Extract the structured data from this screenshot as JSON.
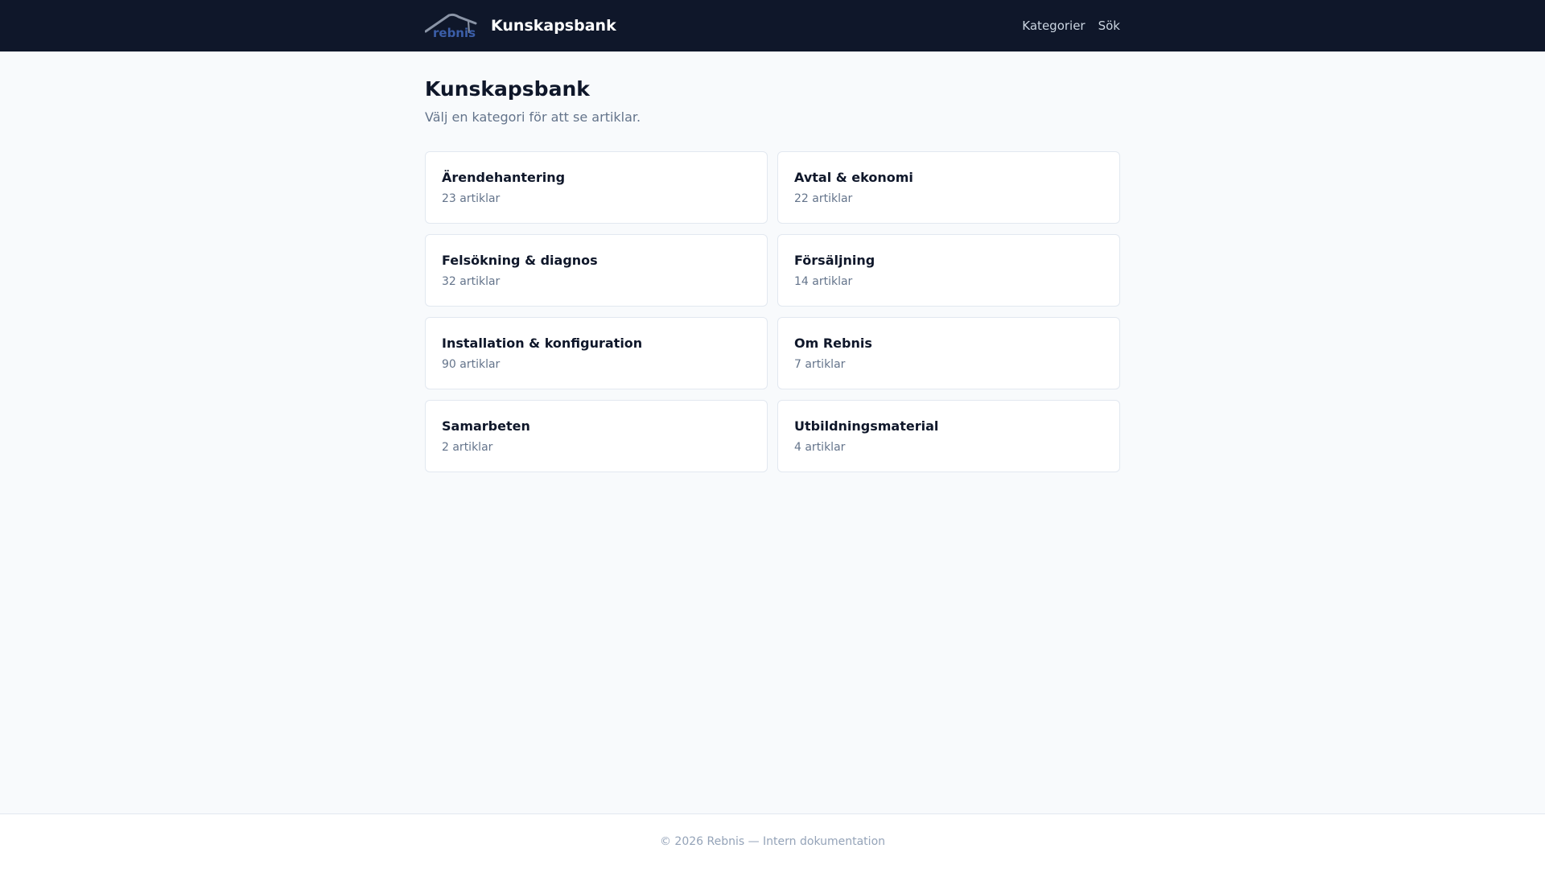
{
  "header": {
    "logo_text": "rebnis",
    "title": "Kunskapsbank",
    "nav": [
      {
        "label": "Kategorier"
      },
      {
        "label": "Sök"
      }
    ]
  },
  "main": {
    "title": "Kunskapsbank",
    "subtitle": "Välj en kategori för att se artiklar.",
    "categories": [
      {
        "name": "Ärendehantering",
        "count": "23 artiklar"
      },
      {
        "name": "Avtal & ekonomi",
        "count": "22 artiklar"
      },
      {
        "name": "Felsökning & diagnos",
        "count": "32 artiklar"
      },
      {
        "name": "Försäljning",
        "count": "14 artiklar"
      },
      {
        "name": "Installation & konfiguration",
        "count": "90 artiklar"
      },
      {
        "name": "Om Rebnis",
        "count": "7 artiklar"
      },
      {
        "name": "Samarbeten",
        "count": "2 artiklar"
      },
      {
        "name": "Utbildningsmaterial",
        "count": "4 artiklar"
      }
    ]
  },
  "footer": {
    "text": "© 2026 Rebnis — Intern dokumentation"
  },
  "colors": {
    "header_bg": "#0f172a",
    "page_bg": "#f8fafc",
    "logo_blue": "#3b5ea8",
    "muted_text": "#64748b"
  }
}
